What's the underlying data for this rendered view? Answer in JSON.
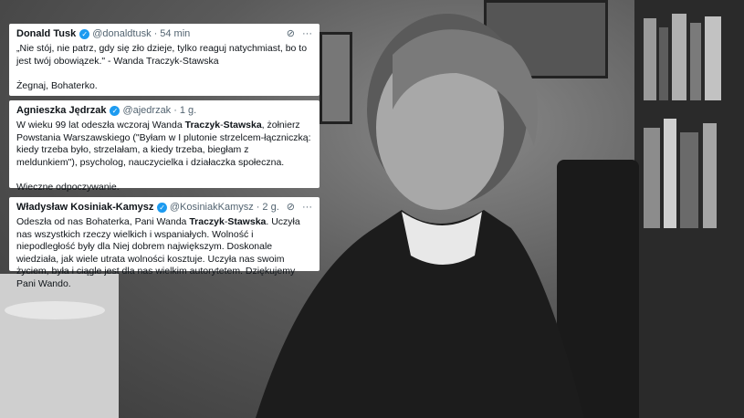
{
  "tweets": [
    {
      "name": "Donald Tusk",
      "handle": "@donaldtusk",
      "time": "54 min",
      "text_plain": "„Nie stój, nie patrz, gdy się zło dzieje, tylko reaguj natychmiast, bo to jest twój obowiązek.\" - Wanda Traczyk-Stawska\n\nŻegnaj, Bohaterko.",
      "text_parts": []
    },
    {
      "name": "Agnieszka Jędrzak",
      "handle": "@ajedrzak",
      "time": "1 g.",
      "text_parts": [
        "W wieku 99 lat odeszła wczoraj Wanda ",
        "Traczyk",
        "-",
        "Stawska",
        ", żołnierz Powstania Warszawskiego (\"Byłam w I plutonie strzelcem-łączniczką: kiedy trzeba było, strzelałam, a kiedy trzeba, biegłam z meldunkiem\"), psycholog, nauczycielka i działaczka społeczna.\n\nWieczne odpoczywanie."
      ]
    },
    {
      "name": "Władysław Kosiniak-Kamysz",
      "handle": "@KosiniakKamysz",
      "time": "2 g.",
      "text_parts": [
        "Odeszła od nas Bohaterka, Pani Wanda ",
        "Traczyk",
        "-",
        "Stawska",
        ". Uczyła nas wszystkich rzeczy wielkich i wspaniałych. Wolność i niepodległość były dla Niej dobrem największym. Doskonale wiedziała, jak wiele utrata wolności kosztuje. Uczyła nas swoim życiem, była i ciągle jest dla nas wielkim autorytetem. Dziękujemy Pani Wando."
      ]
    }
  ],
  "icons": {
    "verified": "verified-badge-icon",
    "grok": "grok-icon",
    "more": "more-icon"
  },
  "colors": {
    "verified": "#1d9bf0",
    "muted": "#536471",
    "text": "#0f1419"
  }
}
